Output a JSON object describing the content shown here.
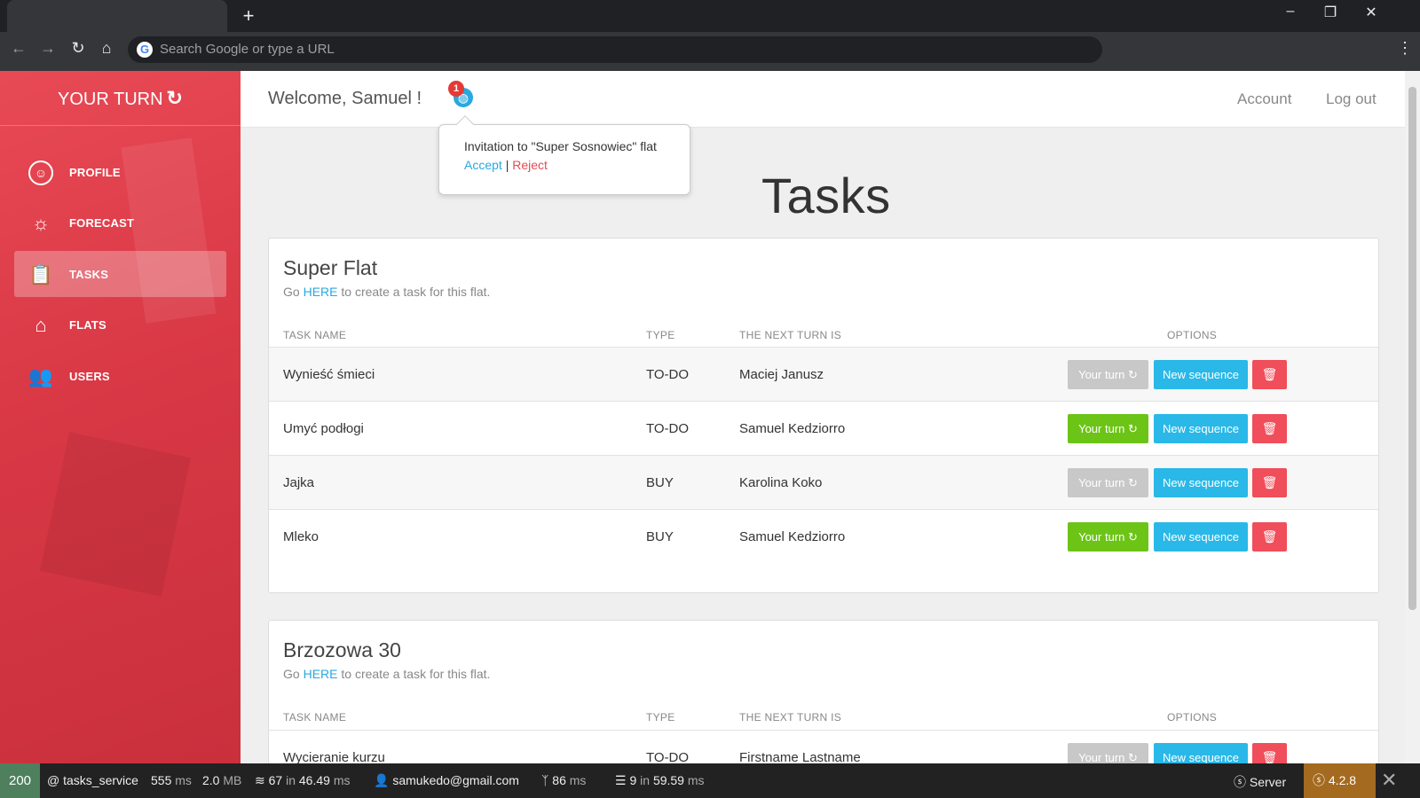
{
  "browser": {
    "new_tab_icon": "+",
    "omnibox_placeholder": "Search Google or type a URL",
    "google_logo": "G"
  },
  "sidebar": {
    "brand": "YOUR TURN",
    "items": [
      {
        "label": "PROFILE",
        "icon": "profile-icon"
      },
      {
        "label": "FORECAST",
        "icon": "sun-icon"
      },
      {
        "label": "TASKS",
        "icon": "clipboard-icon",
        "active": true
      },
      {
        "label": "FLATS",
        "icon": "house-icon"
      },
      {
        "label": "USERS",
        "icon": "users-icon"
      }
    ]
  },
  "header": {
    "welcome": "Welcome, Samuel !",
    "notification_count": "1",
    "account": "Account",
    "logout": "Log out"
  },
  "popup": {
    "text": "Invitation to \"Super Sosnowiec\" flat",
    "accept": "Accept",
    "separator": " | ",
    "reject": "Reject"
  },
  "page": {
    "title": "Tasks"
  },
  "table_headers": {
    "name": "TASK NAME",
    "type": "TYPE",
    "next": "THE NEXT TURN IS",
    "options": "OPTIONS"
  },
  "buttons": {
    "your_turn": "Your turn",
    "new_sequence": "New sequence",
    "delete_icon": "🗑"
  },
  "flats": [
    {
      "name": "Super Flat",
      "hint_prefix": "Go ",
      "hint_link": "HERE",
      "hint_suffix": " to create a task for this flat.",
      "tasks": [
        {
          "name": "Wynieść śmieci",
          "type": "TO-DO",
          "next": "Maciej Janusz",
          "your_turn_enabled": false
        },
        {
          "name": "Umyć podłogi",
          "type": "TO-DO",
          "next": "Samuel Kedziorro",
          "your_turn_enabled": true
        },
        {
          "name": "Jajka",
          "type": "BUY",
          "next": "Karolina Koko",
          "your_turn_enabled": false
        },
        {
          "name": "Mleko",
          "type": "BUY",
          "next": "Samuel Kedziorro",
          "your_turn_enabled": true
        }
      ]
    },
    {
      "name": "Brzozowa 30",
      "hint_prefix": "Go ",
      "hint_link": "HERE",
      "hint_suffix": " to create a task for this flat.",
      "tasks": [
        {
          "name": "Wycieranie kurzu",
          "type": "TO-DO",
          "next": "Firstname Lastname",
          "your_turn_enabled": false
        }
      ]
    }
  ],
  "debug_toolbar": {
    "status": "200",
    "route": "@ tasks_service",
    "time": "555",
    "time_unit": "ms",
    "memory": "2.0",
    "memory_unit": "MB",
    "queries": "67",
    "queries_in": "in",
    "queries_time": "46.49",
    "queries_unit": "ms",
    "user": "samukedo@gmail.com",
    "twig_time": "86",
    "twig_unit": "ms",
    "cache": "9",
    "cache_in": "in",
    "cache_time": "59.59",
    "cache_unit": "ms",
    "server": "Server",
    "version": "4.2.8"
  },
  "colors": {
    "accent": "#e84a55",
    "info": "#29b8e8",
    "success": "#6cc417",
    "danger": "#f04e5a",
    "disabled": "#c8c8c8"
  }
}
